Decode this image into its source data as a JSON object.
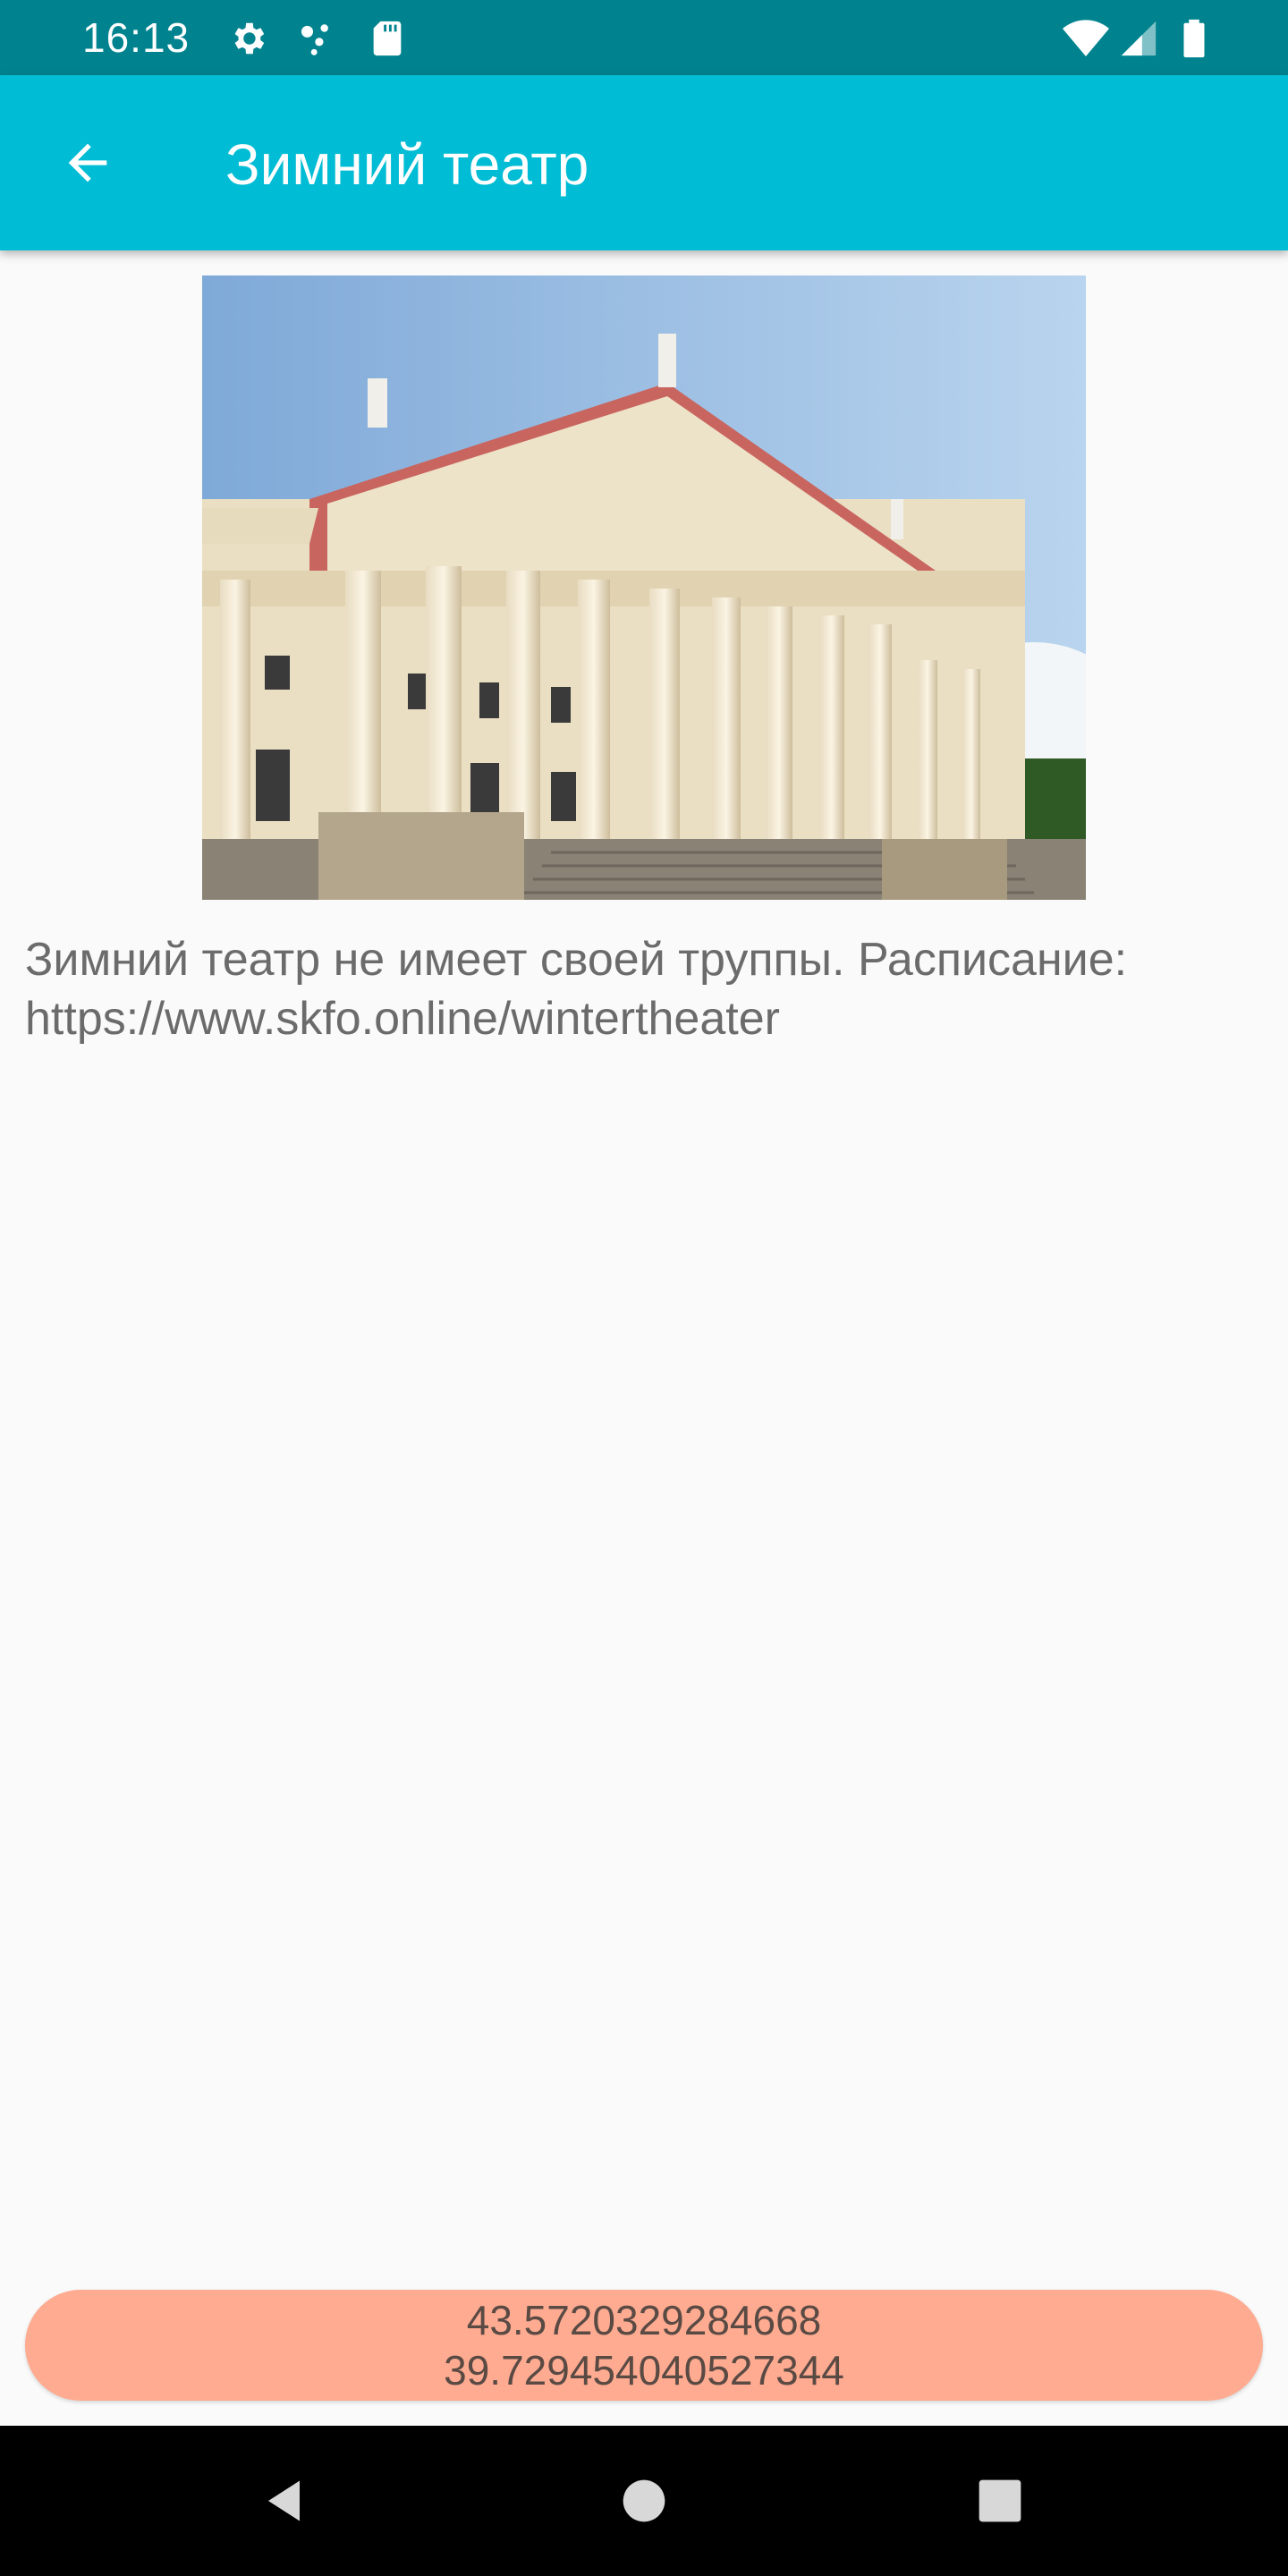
{
  "status_bar": {
    "time": "16:13",
    "icons": [
      "gear-icon",
      "dots-icon",
      "sd-card-icon",
      "wifi-icon",
      "signal-icon",
      "battery-icon"
    ]
  },
  "app_bar": {
    "title": "Зимний театр",
    "back_icon": "arrow-back-icon"
  },
  "content": {
    "image_subject": "Winter Theatre building with columns",
    "description": "Зимний театр не имеет своей труппы. Расписание: https://www.skfo.online/wintertheater"
  },
  "coordinates": {
    "latitude": "43.5720329284668",
    "longitude": "39.729454040527344"
  },
  "nav_bar": {
    "icons": [
      "back-triangle-icon",
      "home-circle-icon",
      "recents-square-icon"
    ]
  },
  "colors": {
    "status_bar": "#00838f",
    "app_bar": "#00bcd4",
    "coords_pill": "#ffab91",
    "background": "#fafafa"
  }
}
